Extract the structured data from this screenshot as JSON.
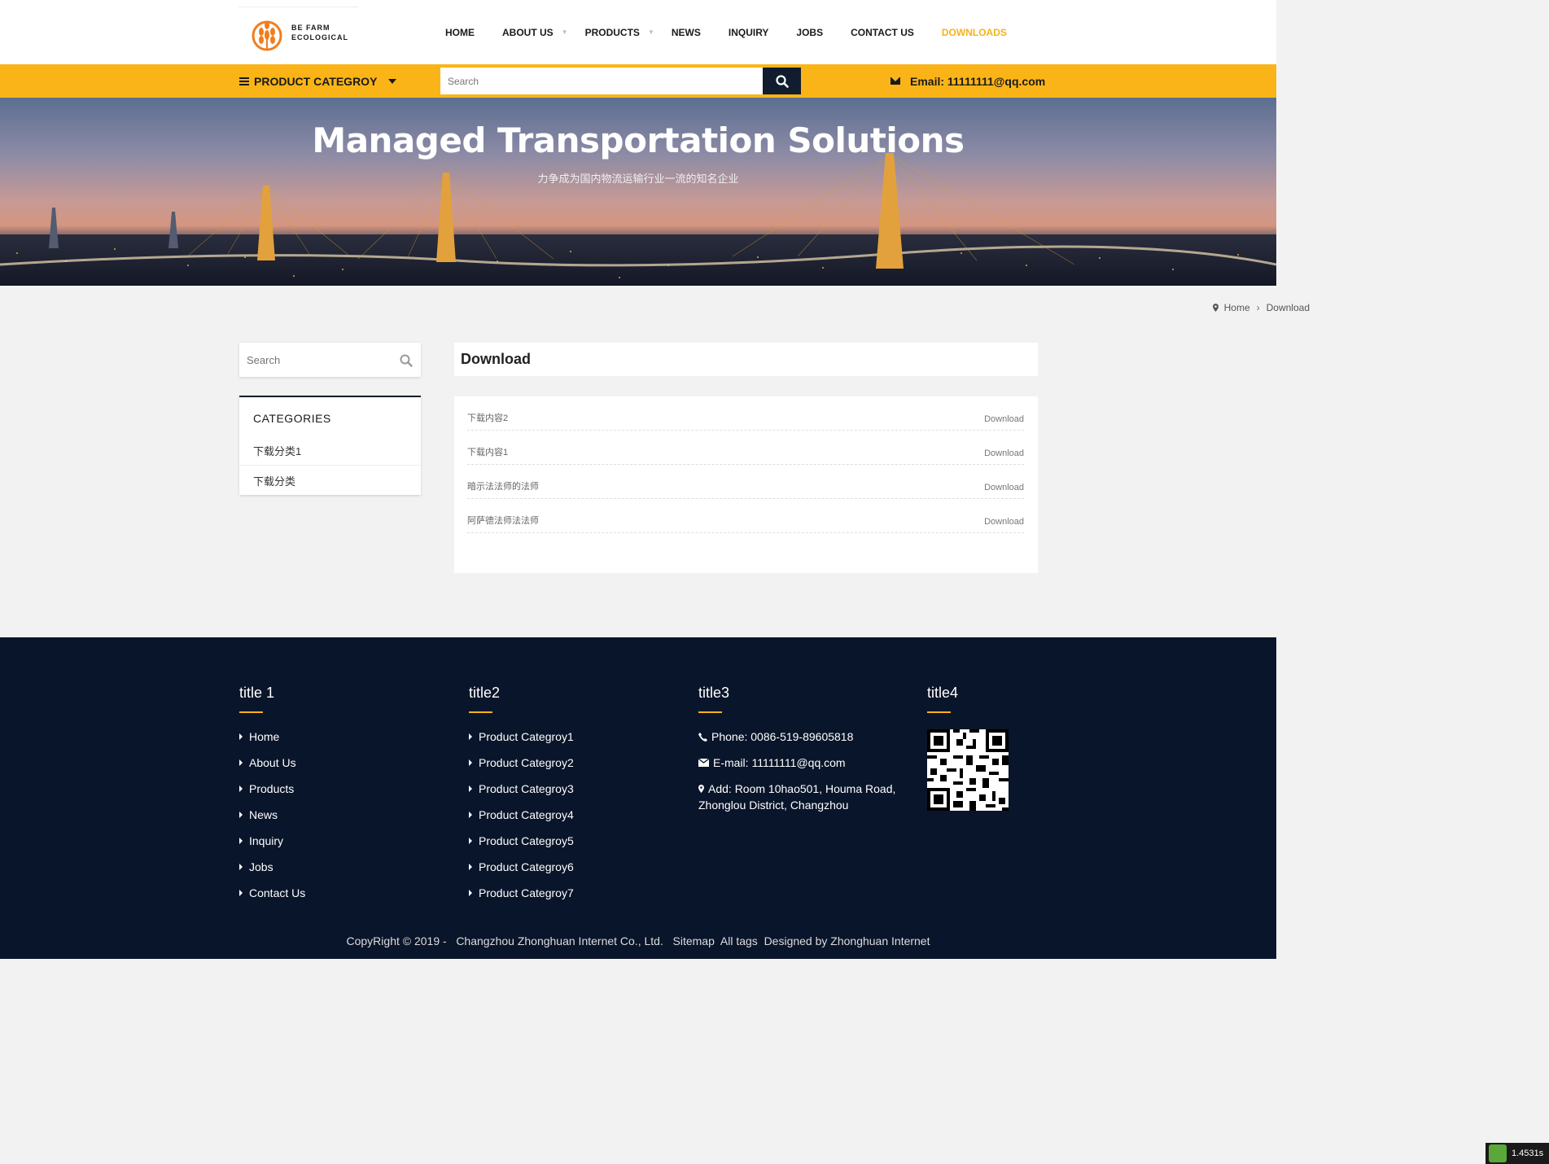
{
  "brand": {
    "line1": "BE FARM",
    "line2": "ECOLOGICAL",
    "accent": "#fbb417",
    "dark": "#09152a"
  },
  "nav": {
    "items": [
      {
        "label": "HOME"
      },
      {
        "label": "ABOUT US"
      },
      {
        "label": "PRODUCTS"
      },
      {
        "label": "NEWS"
      },
      {
        "label": "INQUIRY"
      },
      {
        "label": "JOBS"
      },
      {
        "label": "CONTACT US"
      },
      {
        "label": "DOWNLOADS"
      }
    ]
  },
  "topbar": {
    "category_label": "PRODUCT CATEGROY",
    "search_placeholder": "Search",
    "email": "Email: 11111111@qq.com"
  },
  "banner": {
    "title": "Managed Transportation Solutions",
    "subtitle": "力争成为国内物流运输行业一流的知名企业"
  },
  "breadcrumb": {
    "home": "Home",
    "current": "Download"
  },
  "sidebar": {
    "search_placeholder": "Search",
    "categories_title": "CATEGORIES",
    "categories": [
      "下载分类1",
      "下载分类"
    ]
  },
  "main": {
    "title": "Download",
    "items": [
      {
        "name": "下载内容2",
        "link": "Download"
      },
      {
        "name": "下载内容1",
        "link": "Download"
      },
      {
        "name": "暗示法法师的法师",
        "link": "Download"
      },
      {
        "name": "阿萨德法师法法师",
        "link": "Download"
      }
    ]
  },
  "footer": {
    "col1": {
      "title": "title 1",
      "links": [
        "Home",
        "About Us",
        "Products",
        "News",
        "Inquiry",
        "Jobs",
        "Contact Us"
      ]
    },
    "col2": {
      "title": "title2",
      "links": [
        "Product Categroy1",
        "Product Categroy2",
        "Product Categroy3",
        "Product Categroy4",
        "Product Categroy5",
        "Product Categroy6",
        "Product Categroy7"
      ]
    },
    "col3": {
      "title": "title3",
      "phone": "Phone: 0086-519-89605818",
      "email": "E-mail: 11111111@qq.com",
      "address_line1": "Add: Room 10hao501, Houma Road,",
      "address_line2": "Zhonglou District, Changzhou"
    },
    "col4": {
      "title": "title4"
    },
    "copyright": "CopyRight © 2019 -   Changzhou Zhonghuan Internet Co., Ltd.   Sitemap  All tags  Designed by Zhonghuan Internet"
  },
  "timer": "1.4531s"
}
